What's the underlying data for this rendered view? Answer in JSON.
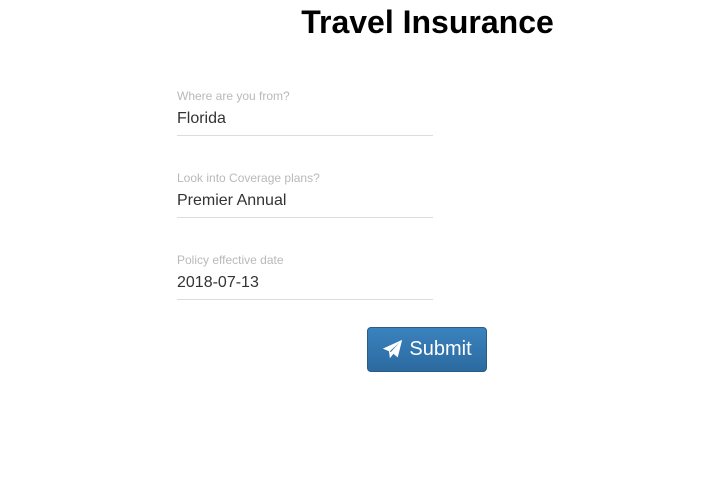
{
  "page": {
    "title": "Travel Insurance"
  },
  "form": {
    "fields": [
      {
        "label": "Where are you from?",
        "value": "Florida"
      },
      {
        "label": "Look into Coverage plans?",
        "value": "Premier Annual"
      },
      {
        "label": "Policy effective date",
        "value": "2018-07-13"
      }
    ],
    "submit": {
      "label": "Submit",
      "icon": "paper-plane-icon"
    }
  },
  "colors": {
    "button": "#3278b4",
    "label": "#b9b9b9",
    "input_text": "#333333"
  }
}
